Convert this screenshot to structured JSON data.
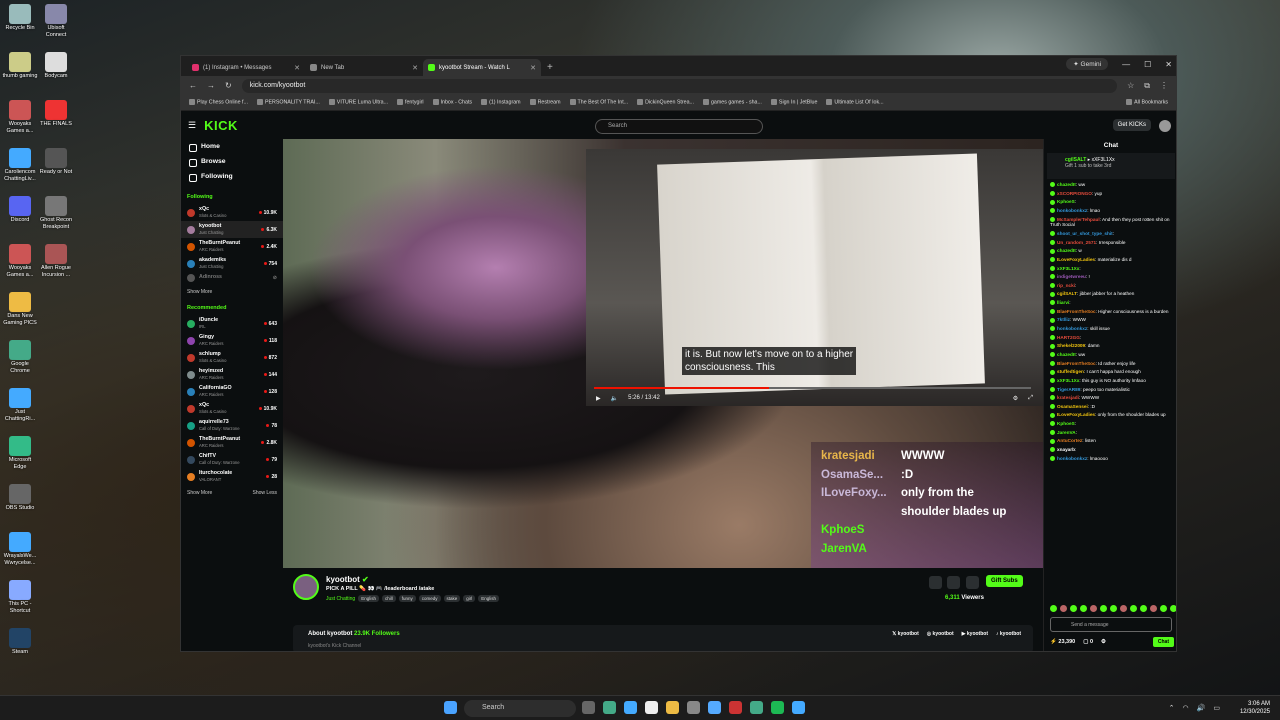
{
  "desktop": {
    "icons_left": [
      "Recycle Bin",
      "thumb gaming",
      "Wooyaks Games a...",
      "Caroliencom ChattingLiv...",
      "Discord",
      "Wooyaks Games a...",
      "Dans New Gaming PICS",
      "Google Chrome",
      "Just ChattingRi...",
      "Microsoft Edge",
      "OBS Studio",
      "WrayalsWe... Wwrycelse...",
      "This PC - Shortcut",
      "Steam"
    ],
    "icons_right": [
      "Ubisoft Connect",
      "Bodycam",
      "THE FINALS",
      "Ready or Not",
      "Ghost Recon Breakpoint",
      "Allen Rogue Incursion ..."
    ]
  },
  "browser": {
    "tabs": [
      {
        "label": "(1) Instagram • Messages",
        "color": "#e1306c"
      },
      {
        "label": "New Tab",
        "color": "#888888"
      },
      {
        "label": "kyootbot Stream - Watch L",
        "color": "#53fc18"
      }
    ],
    "gemini": "Gemini",
    "url": "kick.com/kyootbot",
    "bookmarks": [
      "Play Chess Online f...",
      "PERSONALITY TRAI...",
      "VITURE Luma Ultra...",
      "fentygirl",
      "Inbox - Chats",
      "(1) Instagram",
      "Restream",
      "The Best Of The Int...",
      "DickinQueen Strea...",
      "games games - sha...",
      "Sign In | JetBlue",
      "Ultimate List Of Iok...",
      "All Bookmarks"
    ]
  },
  "kick": {
    "logo": "KICK",
    "search_placeholder": "Search",
    "get_kicks": "Get KICKs",
    "nav": [
      "Home",
      "Browse",
      "Following"
    ],
    "following_header": "Following",
    "following": [
      {
        "name": "xQc",
        "game": "Slots & Casino",
        "viewers": "10.9K",
        "color": "#c0392b"
      },
      {
        "name": "kyootbot",
        "game": "Just Chatting",
        "viewers": "6.3K",
        "color": "#a57c9e"
      },
      {
        "name": "TheBurntPeanut",
        "game": "ARC Raiders",
        "viewers": "2.4K",
        "color": "#d35400"
      },
      {
        "name": "akademiks",
        "game": "Just Chatting",
        "viewers": "754",
        "color": "#2980b9"
      },
      {
        "name": "Adinross",
        "game": "",
        "viewers": "off",
        "color": "#555555"
      }
    ],
    "show_more": "Show More",
    "recommended_header": "Recommended",
    "recommended": [
      {
        "name": "iDuncle",
        "game": "IRL",
        "viewers": "643",
        "color": "#27ae60"
      },
      {
        "name": "Gingy",
        "game": "ARC Raiders",
        "viewers": "118",
        "color": "#8e44ad"
      },
      {
        "name": "schlump",
        "game": "Slots & Casino",
        "viewers": "872",
        "color": "#c0392b"
      },
      {
        "name": "heyimzed",
        "game": "ARC Raiders",
        "viewers": "144",
        "color": "#7f8c8d"
      },
      {
        "name": "CaliforniaGO",
        "game": "ARC Raiders",
        "viewers": "128",
        "color": "#2980b9"
      },
      {
        "name": "xQc",
        "game": "Slots & Casino",
        "viewers": "10.9K",
        "color": "#c0392b"
      },
      {
        "name": "aquirrelle73",
        "game": "Call of Duty: Warzone",
        "viewers": "78",
        "color": "#16a085"
      },
      {
        "name": "TheBurntPeanut",
        "game": "ARC Raiders",
        "viewers": "2.8K",
        "color": "#d35400"
      },
      {
        "name": "ChifTV",
        "game": "Call of Duty: Warzone",
        "viewers": "79",
        "color": "#34495e"
      },
      {
        "name": "Iturchocolate",
        "game": "VALORANT",
        "viewers": "28",
        "color": "#e67e22"
      }
    ],
    "show_more2": "Show More",
    "show_less": "Show Less",
    "subtitle_lines": [
      "it is. But now let's move on to a higher",
      "consciousness. This"
    ],
    "video_time": "5:26 / 13:42",
    "video_progress": 0.4,
    "overlay_chat": [
      {
        "user": "kratesjadi",
        "msg": "WWWW"
      },
      {
        "user": "OsamaSe...",
        "msg": ":D"
      },
      {
        "user": "ILoveFoxy...",
        "msg": "only from the"
      },
      {
        "user": "",
        "msg": "shoulder blades up"
      },
      {
        "user": "KphoeS",
        "msg": ""
      },
      {
        "user": "JarenVA",
        "msg": ""
      }
    ],
    "streamer": {
      "name": "kyootbot",
      "title": "PICK A PILL 💊 👀 🎮 /leaderboard /atake",
      "category": "Just Chatting",
      "tags": [
        "English",
        "chill",
        "funny",
        "comedy",
        "stake",
        "girl",
        "English"
      ],
      "gift": "Gift Subs",
      "viewers": "6,311",
      "viewers_label": "Viewers"
    },
    "about": {
      "label": "About kyootbot",
      "followers": "23.9K Followers",
      "sub": "kyootbot's Kick Channel",
      "socials": [
        "kyootbot",
        "kyootbot",
        "kyootbot",
        "kyootbot"
      ]
    },
    "chat": {
      "title": "Chat",
      "gifted_user": "cgilSALT",
      "gifted_to": "xXF3L1Xx",
      "gifted_msg": "Gift 1 sub to take 3rd",
      "messages": [
        {
          "u": "chazedIt",
          "c": "#53fc18",
          "t": "ww"
        },
        {
          "u": "xSCORPIONGO",
          "c": "#e74c3c",
          "t": "yup"
        },
        {
          "u": "KphoeS",
          "c": "#53fc18",
          "t": ""
        },
        {
          "u": "honkobonkxz",
          "c": "#3498db",
          "t": "lmao"
        },
        {
          "u": "McSamplerTehpaul",
          "c": "#e74c3c",
          "t": "And then they post rotten shit on Truth Social"
        },
        {
          "u": "shoot_ur_shot_type_shit",
          "c": "#3498db",
          "t": ""
        },
        {
          "u": "Un_random_2571",
          "c": "#e74c3c",
          "t": "Irresponsible"
        },
        {
          "u": "chazedIt",
          "c": "#53fc18",
          "t": "w"
        },
        {
          "u": "ILoveFoxyLadies",
          "c": "#f1c40f",
          "t": "materialize dis d"
        },
        {
          "u": "xXF3L1Xx",
          "c": "#53fc18",
          "t": ""
        },
        {
          "u": "indigetwreeu",
          "c": "#9b59b6",
          "t": "!"
        },
        {
          "u": "rip_ncki",
          "c": "#e74c3c",
          "t": ""
        },
        {
          "u": "cgilSALT",
          "c": "#f1c40f",
          "t": "jibber jabber for a heathen"
        },
        {
          "u": "lliarvi",
          "c": "#53fc18",
          "t": ""
        },
        {
          "u": "BlaeFromTheSoc",
          "c": "#e67e22",
          "t": "Higher consciousness is a burden"
        },
        {
          "u": "7ktlliz",
          "c": "#3498db",
          "t": "WWW"
        },
        {
          "u": "honkobonkxz",
          "c": "#3498db",
          "t": "skill issue"
        },
        {
          "u": "HART2GG",
          "c": "#e74c3c",
          "t": ""
        },
        {
          "u": "Shekel22009",
          "c": "#f1c40f",
          "t": "damn"
        },
        {
          "u": "chazedIt",
          "c": "#53fc18",
          "t": "ww"
        },
        {
          "u": "BlaeFromTheSoc",
          "c": "#e67e22",
          "t": "Id rather enjoy life"
        },
        {
          "u": "stuffedtigen",
          "c": "#f1c40f",
          "t": "I can't happa hard enough"
        },
        {
          "u": "xXF3L1Xx",
          "c": "#53fc18",
          "t": "this guy is NO authority lmfaoo"
        },
        {
          "u": "TigerAR89",
          "c": "#3498db",
          "t": "peepo too materialistic"
        },
        {
          "u": "kratesjadi",
          "c": "#e74c3c",
          "t": "WWWW"
        },
        {
          "u": "OsamaSensei",
          "c": "#f1c40f",
          "t": ":D"
        },
        {
          "u": "ILoveFoxyLadies",
          "c": "#f1c40f",
          "t": "only from the shoulder blades up"
        },
        {
          "u": "KphoeS",
          "c": "#53fc18",
          "t": ""
        },
        {
          "u": "JarenVA",
          "c": "#53fc18",
          "t": ""
        },
        {
          "u": "AntuCortez",
          "c": "#e67e22",
          "t": "listen"
        },
        {
          "u": "xnayarb",
          "c": "#ffffff",
          "t": ""
        },
        {
          "u": "honkobonkxz",
          "c": "#3498db",
          "t": "lmaoooo"
        }
      ],
      "placeholder": "Send a message",
      "points": "23,390",
      "count": "0",
      "send": "Chat"
    }
  },
  "taskbar": {
    "search": "Search",
    "time": "3:06 AM",
    "date": "12/30/2025"
  }
}
